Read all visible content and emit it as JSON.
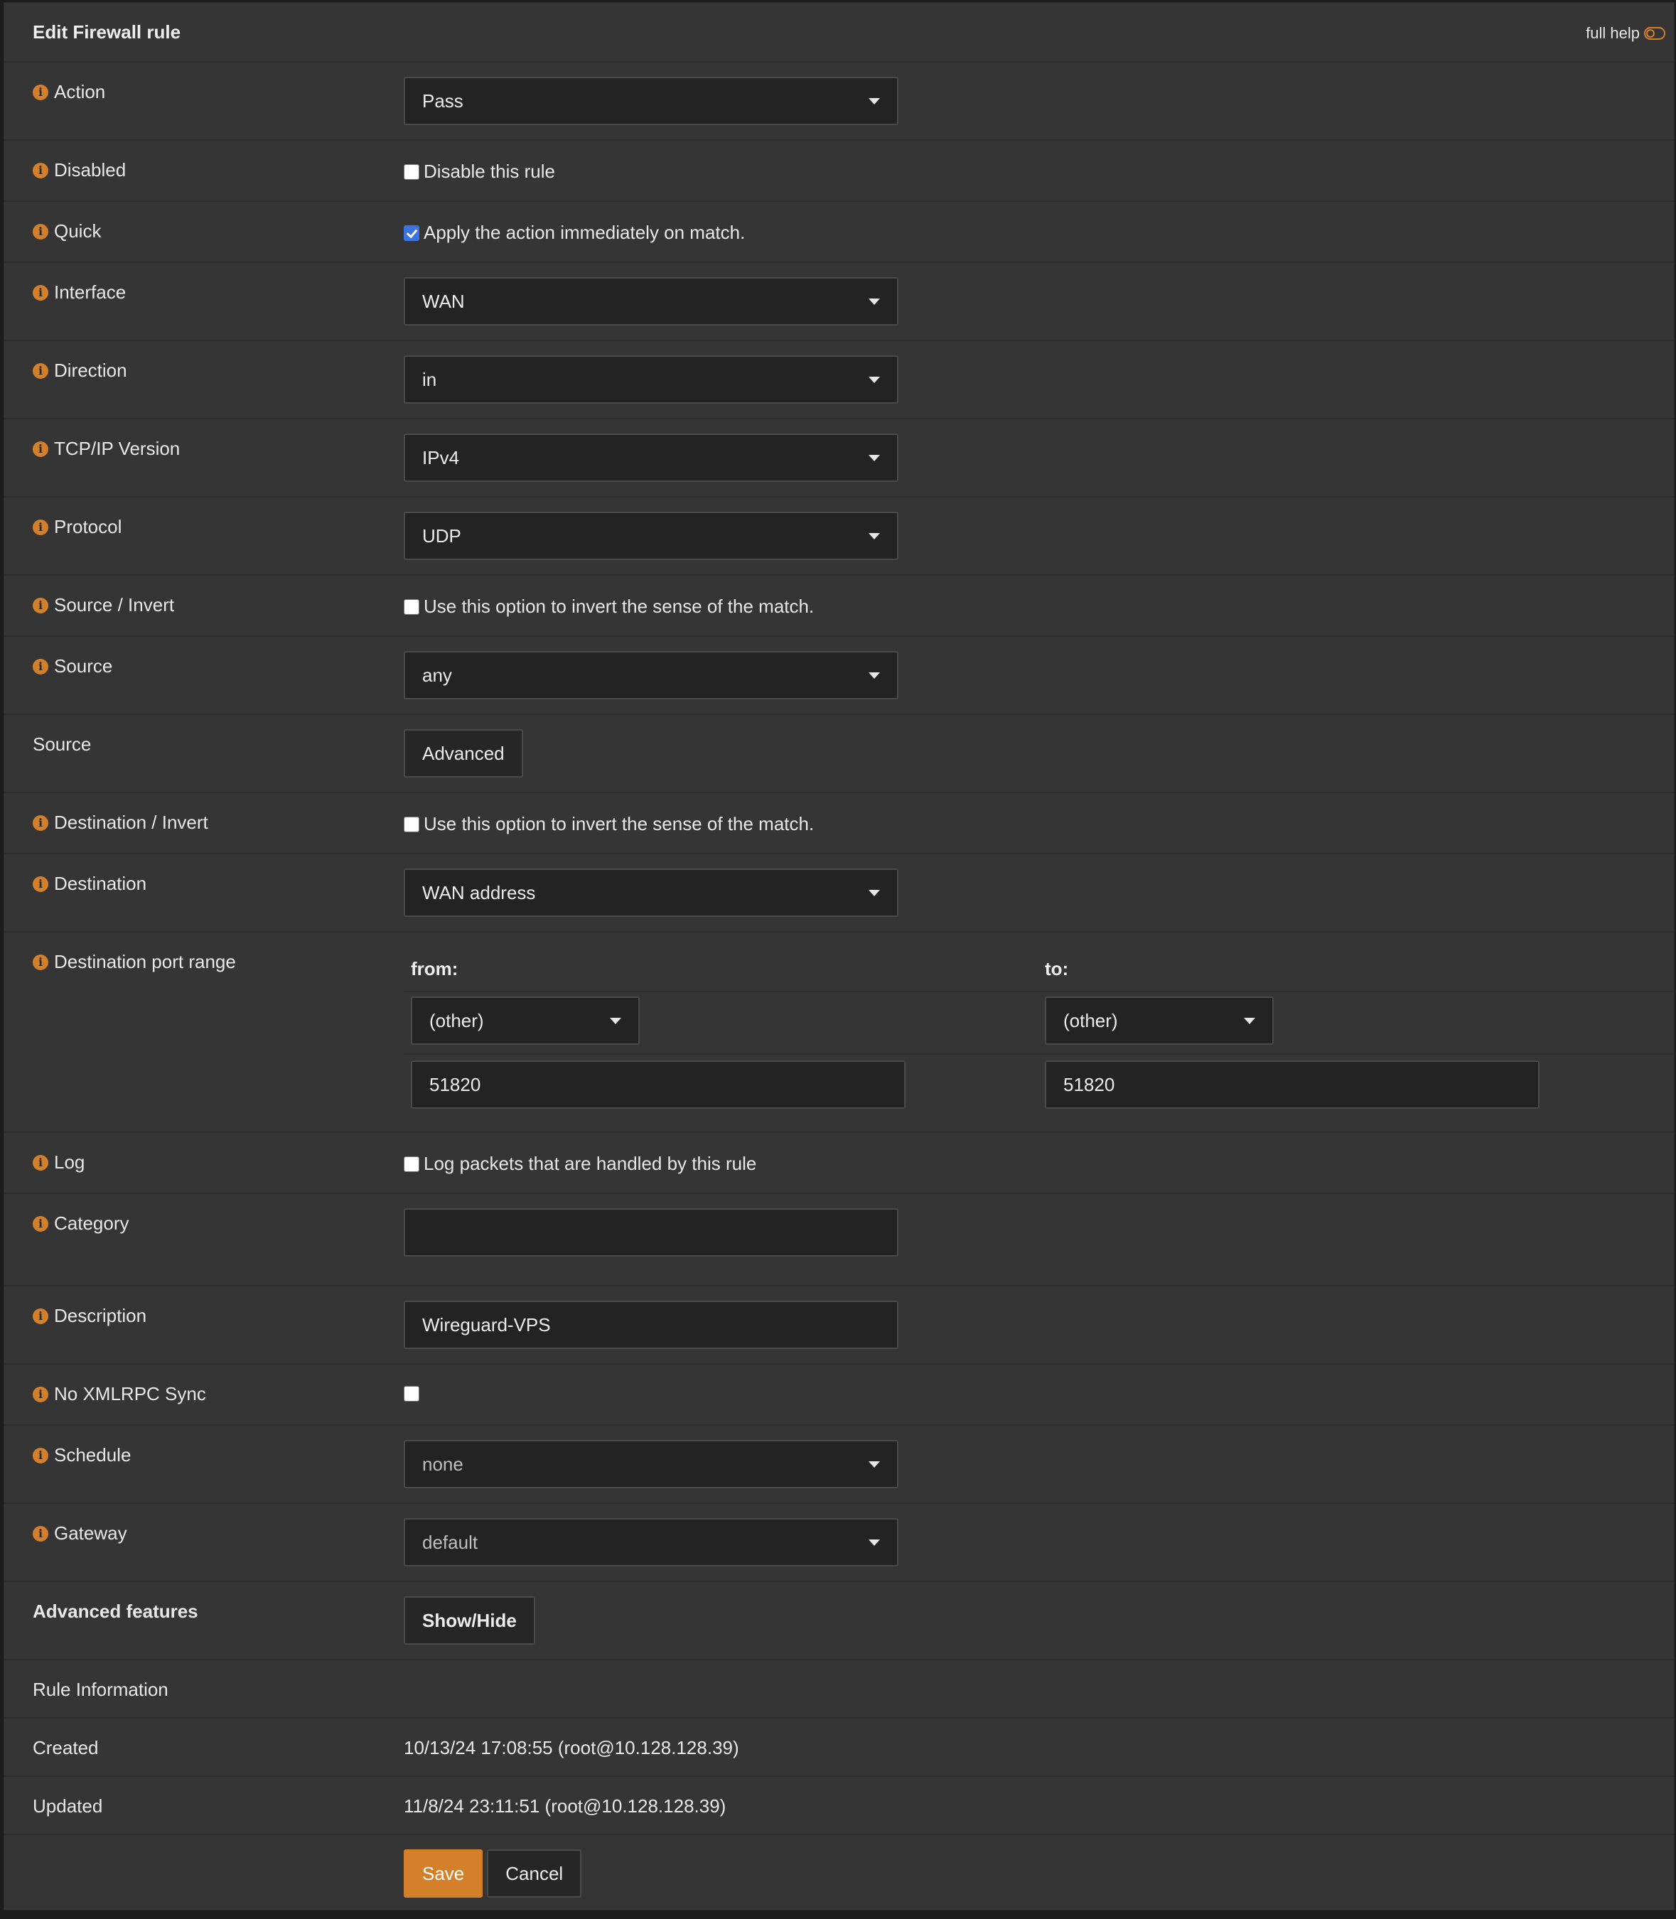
{
  "header": {
    "title": "Edit Firewall rule",
    "full_help": "full help"
  },
  "rows": {
    "action": {
      "label": "Action",
      "value": "Pass"
    },
    "disabled": {
      "label": "Disabled",
      "text": "Disable this rule",
      "checked": false
    },
    "quick": {
      "label": "Quick",
      "text": "Apply the action immediately on match.",
      "checked": true
    },
    "interface": {
      "label": "Interface",
      "value": "WAN"
    },
    "direction": {
      "label": "Direction",
      "value": "in"
    },
    "ipversion": {
      "label": "TCP/IP Version",
      "value": "IPv4"
    },
    "protocol": {
      "label": "Protocol",
      "value": "UDP"
    },
    "source_invert": {
      "label": "Source / Invert",
      "text": "Use this option to invert the sense of the match.",
      "checked": false
    },
    "source": {
      "label": "Source",
      "value": "any"
    },
    "source_adv": {
      "label": "Source",
      "button": "Advanced"
    },
    "dest_invert": {
      "label": "Destination / Invert",
      "text": "Use this option to invert the sense of the match.",
      "checked": false
    },
    "destination": {
      "label": "Destination",
      "value": "WAN address"
    },
    "dest_port": {
      "label": "Destination port range",
      "from_label": "from:",
      "to_label": "to:",
      "from_select": "(other)",
      "to_select": "(other)",
      "from_value": "51820",
      "to_value": "51820"
    },
    "log": {
      "label": "Log",
      "text": "Log packets that are handled by this rule",
      "checked": false
    },
    "category": {
      "label": "Category",
      "value": ""
    },
    "description": {
      "label": "Description",
      "value": "Wireguard-VPS"
    },
    "noxmlrpc": {
      "label": "No XMLRPC Sync",
      "checked": false
    },
    "schedule": {
      "label": "Schedule",
      "value": "none"
    },
    "gateway": {
      "label": "Gateway",
      "value": "default"
    },
    "advanced": {
      "label": "Advanced features",
      "button": "Show/Hide"
    },
    "rule_info": {
      "label": "Rule Information"
    },
    "created": {
      "label": "Created",
      "value": "10/13/24 17:08:55 (root@10.128.128.39)"
    },
    "updated": {
      "label": "Updated",
      "value": "11/8/24 23:11:51 (root@10.128.128.39)"
    }
  },
  "footer": {
    "save": "Save",
    "cancel": "Cancel"
  },
  "colors": {
    "accent": "#d4802b",
    "panel": "#353535",
    "checkbox_checked": "#3b74e0"
  }
}
